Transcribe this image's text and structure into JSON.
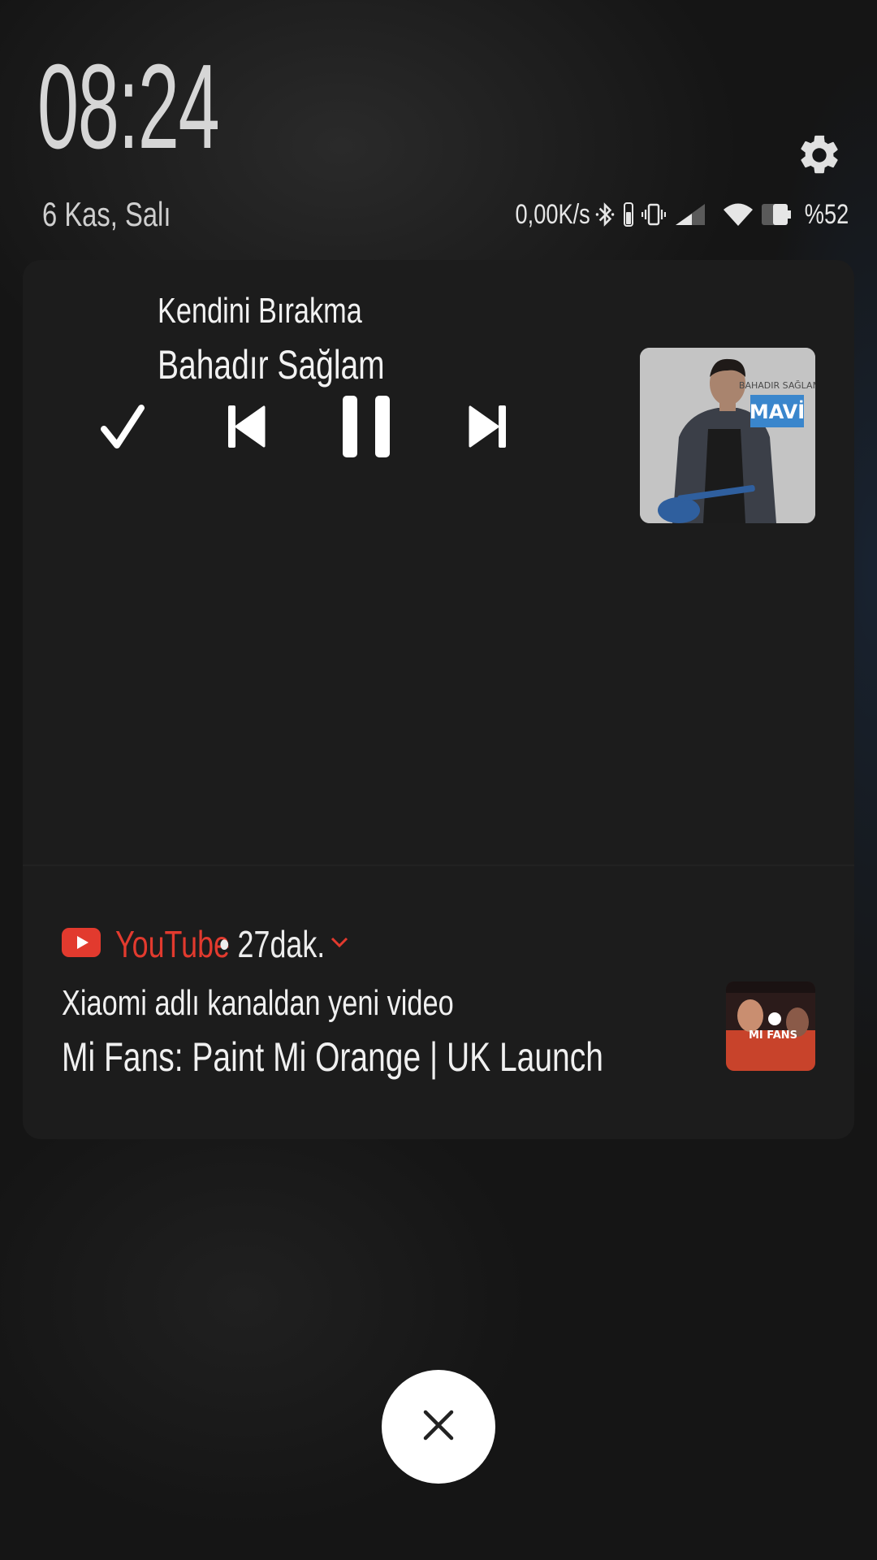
{
  "lockscreen": {
    "time": "08:24",
    "date": "6 Kas, Salı"
  },
  "status_bar": {
    "network_speed": "0,00K/s",
    "battery_percent": "%52",
    "icons": [
      "bluetooth-icon",
      "headset-battery-icon",
      "vibrate-icon",
      "signal-icon",
      "wifi-icon",
      "battery-icon"
    ]
  },
  "media_notification": {
    "song_title": "Kendini Bırakma",
    "artist": "Bahadır Sağlam",
    "album_art_text": "BAHADIR SAĞLAM",
    "album_art_logo": "MAVİ",
    "controls": [
      "check-icon",
      "previous-icon",
      "pause-icon",
      "next-icon"
    ]
  },
  "youtube_notification": {
    "app_name": "YouTube",
    "time": "• 27dak.",
    "line1": "Xiaomi adlı kanaldan yeni video",
    "line2": "Mi Fans: Paint Mi Orange | UK Launch",
    "thumbnail_text": "MI FANS",
    "accent_color": "#e23a2e"
  }
}
